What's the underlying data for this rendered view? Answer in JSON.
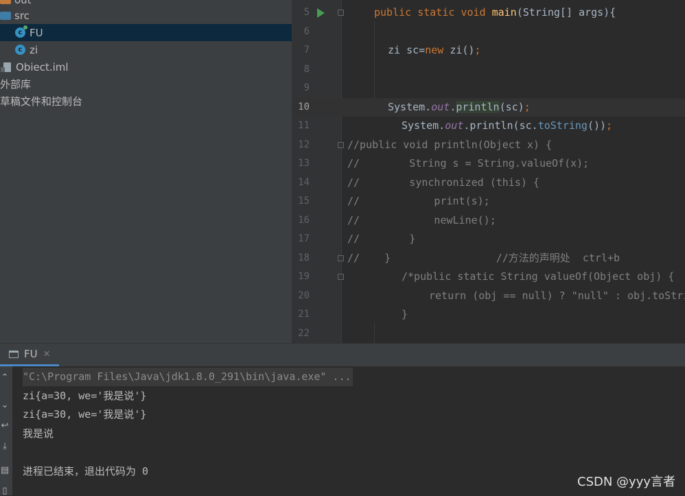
{
  "project_tree": {
    "items": [
      {
        "label": "out"
      },
      {
        "label": "src"
      },
      {
        "label": "FU"
      },
      {
        "label": "zi"
      },
      {
        "label": "Obiect.iml"
      },
      {
        "label": "外部库"
      },
      {
        "label": "草稿文件和控制台"
      }
    ]
  },
  "editor": {
    "line_numbers": [
      "5",
      "6",
      "7",
      "8",
      "9",
      "10",
      "11",
      "12",
      "13",
      "14",
      "15",
      "16",
      "17",
      "18",
      "19",
      "20",
      "21",
      "22"
    ],
    "current_line": "10"
  },
  "run_panel": {
    "tab_label": "FU",
    "output": [
      "\"C:\\Program Files\\Java\\jdk1.8.0_291\\bin\\java.exe\" ...",
      "zi{a=30, we='我是说'}",
      "zi{a=30, we='我是说'}",
      "我是说",
      "",
      "进程已结束，退出代码为 0"
    ]
  },
  "watermark": "CSDN @yyy言者",
  "colors": {
    "sidebar_bg": "#3c3f41",
    "editor_bg": "#2b2b2b",
    "selection": "#0d293e",
    "keyword": "#cc7832",
    "method": "#ffc66d",
    "field": "#9876aa",
    "comment": "#808080"
  }
}
